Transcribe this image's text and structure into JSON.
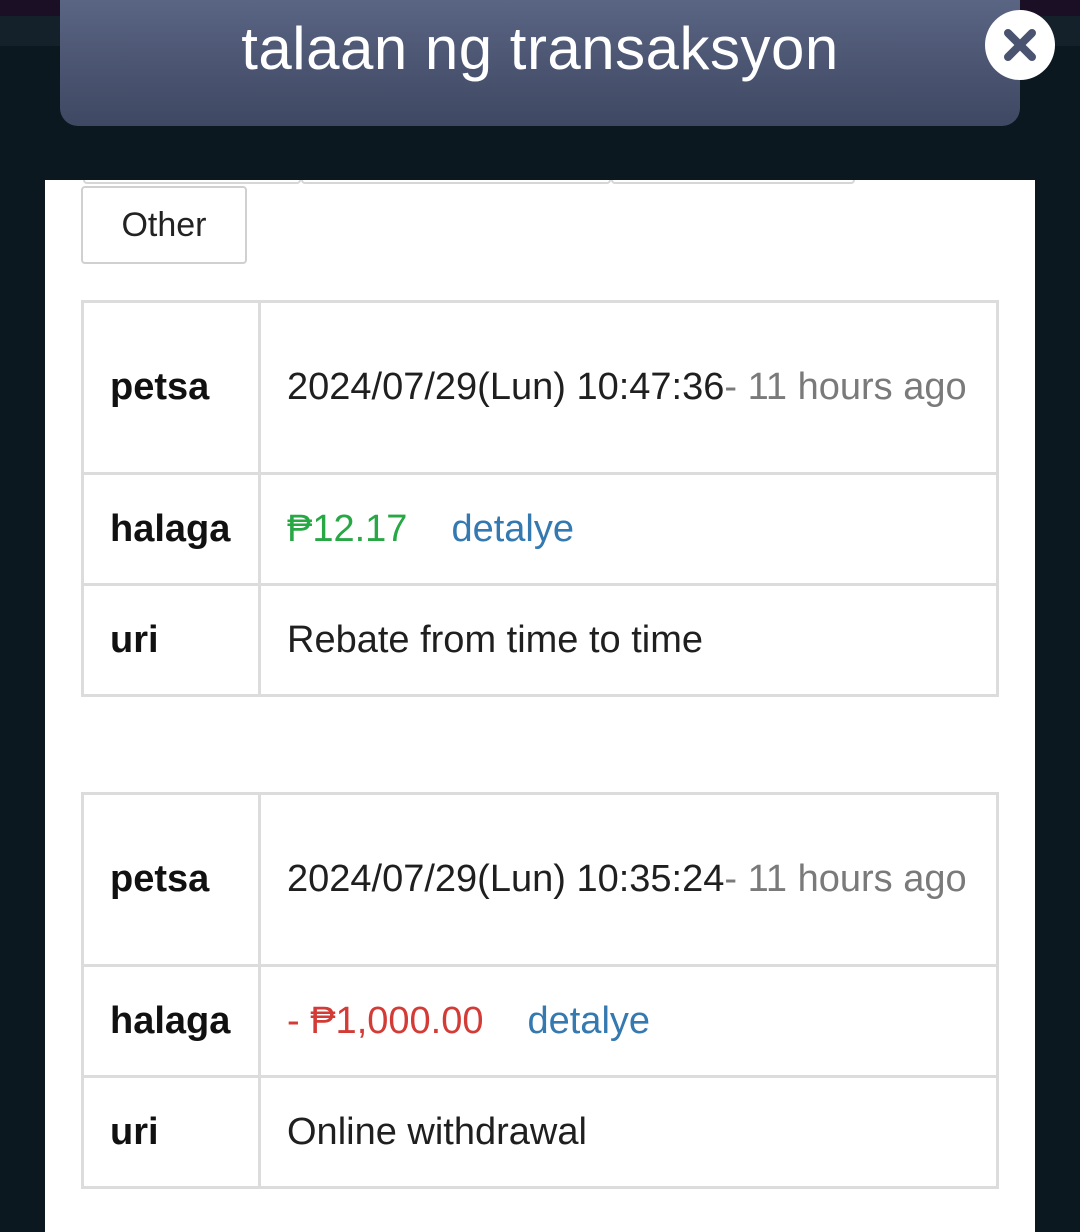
{
  "header": {
    "title": "talaan ng transaksyon",
    "close_icon": "close-icon"
  },
  "filter": {
    "selected_tab": "Other"
  },
  "labels": {
    "date": "petsa",
    "amount": "halaga",
    "type": "uri",
    "detail": "detalye"
  },
  "transactions": [
    {
      "date": "2024/07/29(Lun) 10:47:36",
      "relative": "- 11 hours ago",
      "amount": "₱12.17",
      "amount_sign": "positive",
      "type": "Rebate from time to time"
    },
    {
      "date": "2024/07/29(Lun) 10:35:24",
      "relative": "- 11 hours ago",
      "amount": "- ₱1,000.00",
      "amount_sign": "negative",
      "type": "Online withdrawal"
    }
  ],
  "colors": {
    "positive": "#28a745",
    "negative": "#d33b36",
    "link": "#3479b0",
    "header_bg": "#49536f"
  }
}
